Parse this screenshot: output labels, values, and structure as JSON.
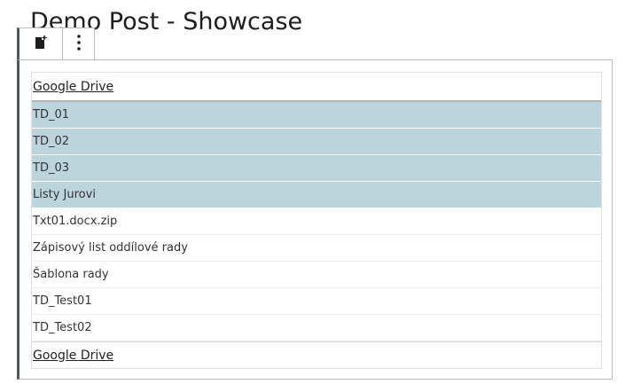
{
  "post": {
    "title": "Demo Post - Showcase"
  },
  "toolbar": {
    "block_type_icon": "document-add-icon",
    "more_options_icon": "vertical-ellipsis-icon"
  },
  "table": {
    "header_link": "Google Drive",
    "footer_link": "Google Drive",
    "highlight_color": "#bcd5dc",
    "rows": [
      {
        "name": "TD_01",
        "highlighted": true
      },
      {
        "name": "TD_02",
        "highlighted": true
      },
      {
        "name": "TD_03",
        "highlighted": true
      },
      {
        "name": "Listy Jurovi",
        "highlighted": true
      },
      {
        "name": "Txt01.docx.zip",
        "highlighted": false
      },
      {
        "name": "Zápisový list oddílové rady",
        "highlighted": false
      },
      {
        "name": "Šablona rady",
        "highlighted": false
      },
      {
        "name": "TD_Test01",
        "highlighted": false
      },
      {
        "name": "TD_Test02",
        "highlighted": false
      }
    ]
  }
}
